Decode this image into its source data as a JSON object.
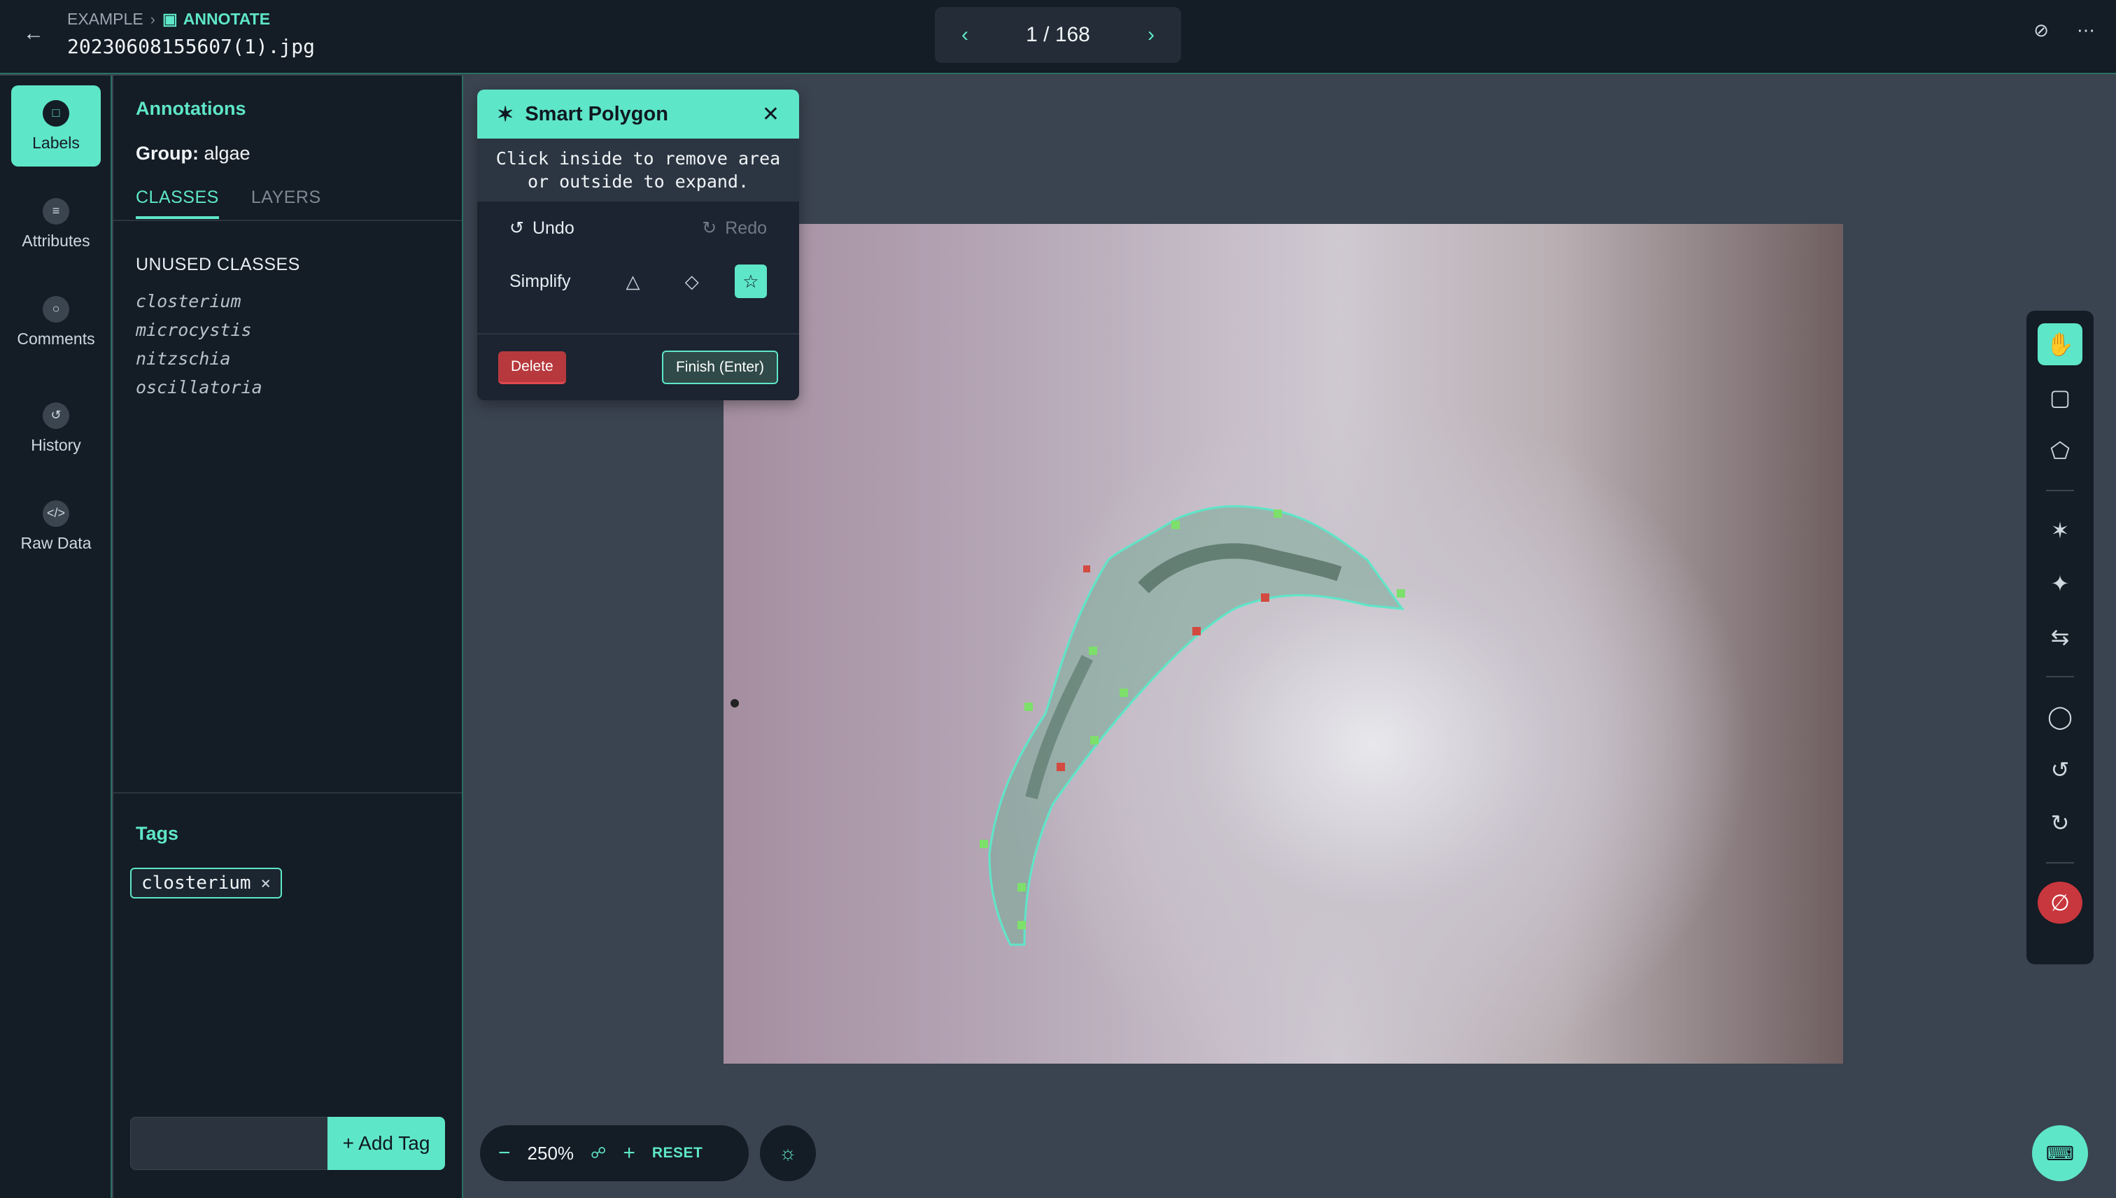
{
  "breadcrumb": {
    "project": "EXAMPLE",
    "mode": "ANNOTATE"
  },
  "file": {
    "name": "20230608155607(1).jpg"
  },
  "pager": {
    "label": "1 / 168"
  },
  "rail": [
    {
      "key": "labels",
      "label": "Labels"
    },
    {
      "key": "attributes",
      "label": "Attributes"
    },
    {
      "key": "comments",
      "label": "Comments"
    },
    {
      "key": "history",
      "label": "History"
    },
    {
      "key": "raw",
      "label": "Raw Data"
    }
  ],
  "panel": {
    "title": "Annotations",
    "group_label": "Group:",
    "group_value": "algae",
    "tabs": [
      "CLASSES",
      "LAYERS"
    ],
    "unused_title": "UNUSED CLASSES",
    "classes": [
      "closterium",
      "microcystis",
      "nitzschia",
      "oscillatoria"
    ],
    "tags_title": "Tags",
    "tags": [
      "closterium"
    ],
    "add_tag_label": "+ Add Tag",
    "tag_input_placeholder": ""
  },
  "smart_polygon": {
    "title": "Smart Polygon",
    "message_line1": "Click inside to remove area",
    "message_line2": "or outside to expand.",
    "undo": "Undo",
    "redo": "Redo",
    "simplify": "Simplify",
    "delete": "Delete",
    "finish": "Finish (Enter)"
  },
  "zoom": {
    "value": "250%",
    "reset": "RESET"
  },
  "colors": {
    "accent": "#5ee6c8",
    "danger": "#c8373d",
    "bg": "#141c25",
    "canvas": "#3a4350"
  }
}
